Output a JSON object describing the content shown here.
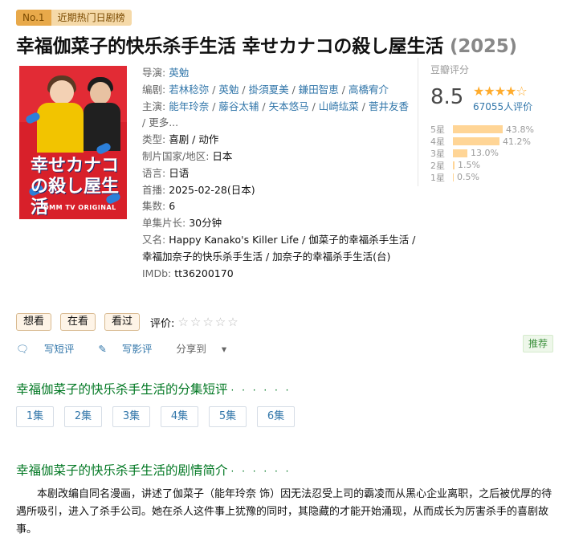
{
  "rank": {
    "no": "No.1",
    "name": "近期热门日剧榜"
  },
  "title": {
    "main": "幸福伽菜子的快乐杀手生活 幸せカナコの殺し屋生活",
    "year": "(2025)"
  },
  "poster": {
    "title": "幸せカナコの殺し屋生活",
    "logo": "DMM TV ORIGINAL"
  },
  "info": {
    "director_label": "导演:",
    "director": "英勉",
    "writer_label": "编剧:",
    "writers": [
      "若林稔弥",
      "英勉",
      "掛須夏美",
      "鎌田智恵",
      "高橋宥介"
    ],
    "cast_label": "主演:",
    "cast": [
      "能年玲奈",
      "藤谷太辅",
      "矢本悠马",
      "山崎纮菜",
      "菅井友香"
    ],
    "more": "更多...",
    "genre_label": "类型:",
    "genre": "喜剧 / 动作",
    "country_label": "制片国家/地区:",
    "country": "日本",
    "language_label": "语言:",
    "language": "日语",
    "premiere_label": "首播:",
    "premiere": "2025-02-28(日本)",
    "episodes_label": "集数:",
    "episodes": "6",
    "runtime_label": "单集片长:",
    "runtime": "30分钟",
    "aka_label": "又名:",
    "aka_line1": "Happy Kanako's Killer Life / 伽菜子的幸福杀手生活 /",
    "aka_line2": "幸福加奈子的快乐杀手生活 / 加奈子的幸福杀手生活(台)",
    "imdb_label": "IMDb:",
    "imdb": "tt36200170"
  },
  "rating": {
    "label": "豆瓣评分",
    "score": "8.5",
    "stars": "★★★★☆",
    "votes": "67055人评价",
    "bars": [
      {
        "label": "5星",
        "pct": "43.8%",
        "value": 43.8
      },
      {
        "label": "4星",
        "pct": "41.2%",
        "value": 41.2
      },
      {
        "label": "3星",
        "pct": "13.0%",
        "value": 13.0
      },
      {
        "label": "2星",
        "pct": "1.5%",
        "value": 1.5
      },
      {
        "label": "1星",
        "pct": "0.5%",
        "value": 0.5
      }
    ]
  },
  "actions": {
    "want": "想看",
    "watching": "在看",
    "watched": "看过",
    "rate_label": "评价:",
    "empty_stars": "☆☆☆☆☆"
  },
  "ops": {
    "short_review": "写短评",
    "review": "写影评",
    "share": "分享到",
    "share_arrow": "▾"
  },
  "recommend": "推荐",
  "episodes_section": {
    "title": "幸福伽菜子的快乐杀手生活的分集短评",
    "dots": "· · · · · ·",
    "items": [
      "1集",
      "2集",
      "3集",
      "4集",
      "5集",
      "6集"
    ]
  },
  "synopsis_section": {
    "title": "幸福伽菜子的快乐杀手生活的剧情简介",
    "dots": "· · · · · ·",
    "text": "本剧改编自同名漫画，讲述了伽菜子（能年玲奈 饰）因无法忍受上司的霸凌而从黑心企业离职，之后被优厚的待遇所吸引，进入了杀手公司。她在杀人这件事上犹豫的同时，其隐藏的才能开始涌现，从而成长为厉害杀手的喜剧故事。"
  },
  "colors": {
    "link": "#3377aa",
    "section": "#007722",
    "star": "#ffac2d",
    "bar": "#ffd596"
  }
}
